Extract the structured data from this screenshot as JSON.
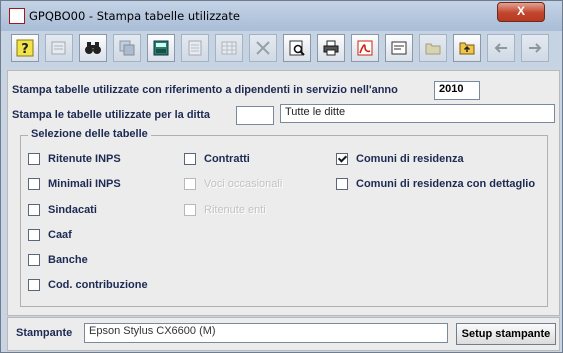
{
  "window": {
    "title": "GPQBO00 - Stampa tabelle utilizzate",
    "close_label": "X"
  },
  "toolbar": {
    "buttons": [
      {
        "icon": "help-icon",
        "enabled": true
      },
      {
        "icon": "properties-icon",
        "enabled": false
      },
      {
        "icon": "binoculars-search-icon",
        "enabled": true
      },
      {
        "icon": "copy-record-icon",
        "enabled": false
      },
      {
        "icon": "calculator-icon",
        "enabled": true
      },
      {
        "icon": "document-icon",
        "enabled": false
      },
      {
        "icon": "grid-icon",
        "enabled": false
      },
      {
        "icon": "delete-icon",
        "enabled": false
      },
      {
        "icon": "print-preview-icon",
        "enabled": true
      },
      {
        "icon": "printer-icon",
        "enabled": true
      },
      {
        "icon": "pdf-icon",
        "enabled": true
      },
      {
        "icon": "form-icon",
        "enabled": true
      },
      {
        "icon": "open-folder-icon",
        "enabled": false
      },
      {
        "icon": "up-folder-icon",
        "enabled": true
      },
      {
        "icon": "arrow-left-icon",
        "enabled": false
      },
      {
        "icon": "arrow-right-icon",
        "enabled": false
      }
    ]
  },
  "form": {
    "year_label": "Stampa tabelle utilizzate con riferimento a dipendenti in servizio nell'anno",
    "year_value": "2010",
    "company_label": "Stampa le tabelle utilizzate per la ditta",
    "company_code": "",
    "company_name": "Tutte le ditte"
  },
  "selection": {
    "legend": "Selezione delle tabelle",
    "col1": [
      {
        "label": "Ritenute INPS",
        "checked": false,
        "enabled": true
      },
      {
        "label": "Minimali INPS",
        "checked": false,
        "enabled": true
      },
      {
        "label": "Sindacati",
        "checked": false,
        "enabled": true
      },
      {
        "label": "Caaf",
        "checked": false,
        "enabled": true
      },
      {
        "label": "Banche",
        "checked": false,
        "enabled": true
      },
      {
        "label": "Cod. contribuzione",
        "checked": false,
        "enabled": true
      }
    ],
    "col2": [
      {
        "label": "Contratti",
        "checked": false,
        "enabled": true
      },
      {
        "label": "Voci occasionali",
        "checked": false,
        "enabled": false
      },
      {
        "label": "Ritenute enti",
        "checked": false,
        "enabled": false
      }
    ],
    "col3": [
      {
        "label": "Comuni di residenza",
        "checked": true,
        "enabled": true
      },
      {
        "label": "Comuni di residenza con dettaglio",
        "checked": false,
        "enabled": true
      }
    ]
  },
  "footer": {
    "printer_label": "Stampante",
    "printer_value": "Epson Stylus CX6600 (M)",
    "setup_label": "Setup stampante"
  },
  "colors": {
    "title_bar": "#b6c8df",
    "close_button": "#c1452d",
    "label_text": "#1d2a52",
    "panel": "#ececec"
  }
}
